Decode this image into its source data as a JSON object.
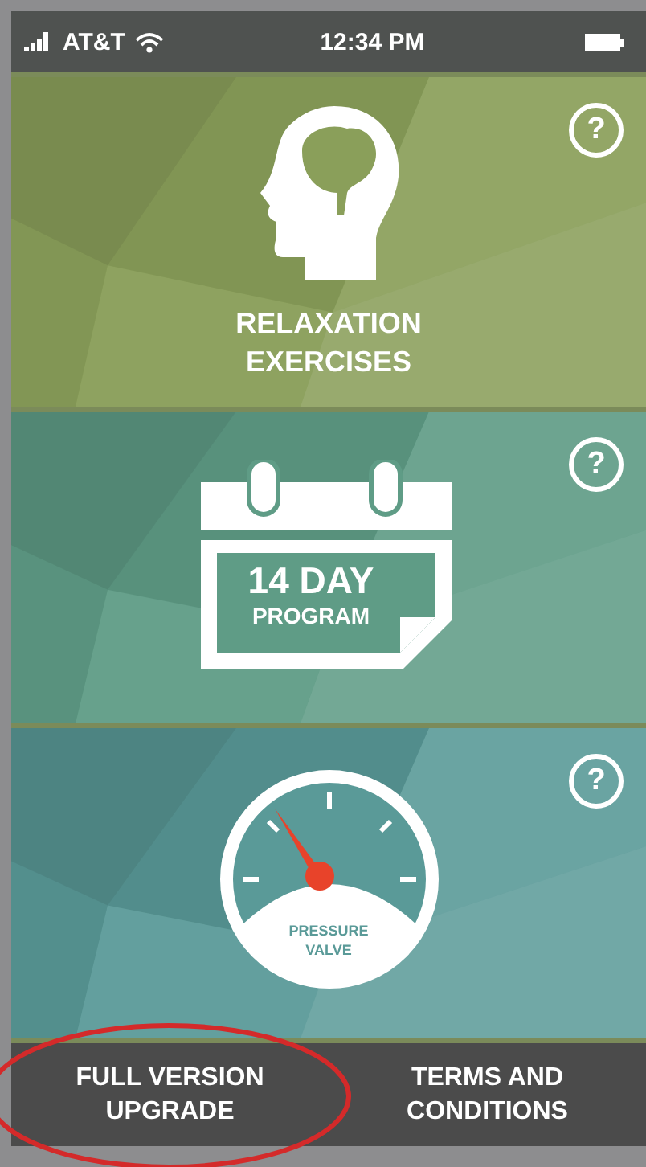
{
  "status_bar": {
    "carrier": "AT&T",
    "time": "12:34 PM"
  },
  "tiles": [
    {
      "kind": "brain",
      "color": "#8a9f5a",
      "help": "?",
      "labels": [
        "RELAXATION",
        "EXERCISES"
      ]
    },
    {
      "kind": "calendar",
      "color": "#5f9c86",
      "help": "?",
      "labels": [
        "14 DAY",
        "PROGRAM"
      ]
    },
    {
      "kind": "gauge",
      "color": "#5a9a98",
      "help": "?",
      "labels": [
        "PRESSURE",
        "VALVE"
      ]
    }
  ],
  "bottom_buttons": [
    {
      "label": "FULL VERSION UPGRADE",
      "circled": true
    },
    {
      "label": "TERMS AND CONDITIONS",
      "circled": false
    }
  ]
}
